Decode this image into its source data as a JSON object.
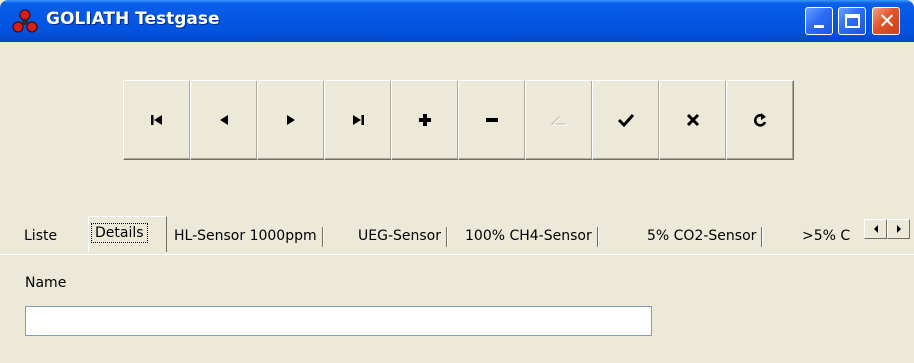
{
  "window": {
    "title": "GOLIATH Testgase",
    "icon": "goliath-app-icon",
    "controls": [
      "minimize-icon",
      "maximize-icon",
      "close-icon"
    ],
    "close_glyph": "✕"
  },
  "toolbar": {
    "buttons": [
      {
        "id": "first",
        "icon": "first-record-icon"
      },
      {
        "id": "prior",
        "icon": "prior-record-icon"
      },
      {
        "id": "next",
        "icon": "next-record-icon"
      },
      {
        "id": "last",
        "icon": "last-record-icon"
      },
      {
        "id": "insert",
        "icon": "plus-icon"
      },
      {
        "id": "delete",
        "icon": "minus-icon"
      },
      {
        "id": "edit",
        "icon": "edit-triangle-icon",
        "disabled": true
      },
      {
        "id": "post",
        "icon": "checkmark-icon"
      },
      {
        "id": "cancel",
        "icon": "x-icon"
      },
      {
        "id": "refresh",
        "icon": "refresh-icon"
      }
    ]
  },
  "tabs": {
    "items": [
      {
        "label": "Liste",
        "active": false
      },
      {
        "label": "Details",
        "active": true
      },
      {
        "label": "HL-Sensor 1000ppm",
        "active": false
      },
      {
        "label": "UEG-Sensor",
        "active": false
      },
      {
        "label": "100% CH4-Sensor",
        "active": false
      },
      {
        "label": "5% CO2-Sensor",
        "active": false
      },
      {
        "label": ">5% C",
        "active": false
      }
    ],
    "scroll": [
      "scroll-left-icon",
      "scroll-right-icon"
    ]
  },
  "details": {
    "name_label": "Name",
    "name_value": "",
    "name_placeholder": ""
  },
  "colors": {
    "face": "#ece9d8",
    "titlebar": "#0458e4",
    "close_button": "#e3542a",
    "disabled_glyph": "#c7c3b4"
  }
}
